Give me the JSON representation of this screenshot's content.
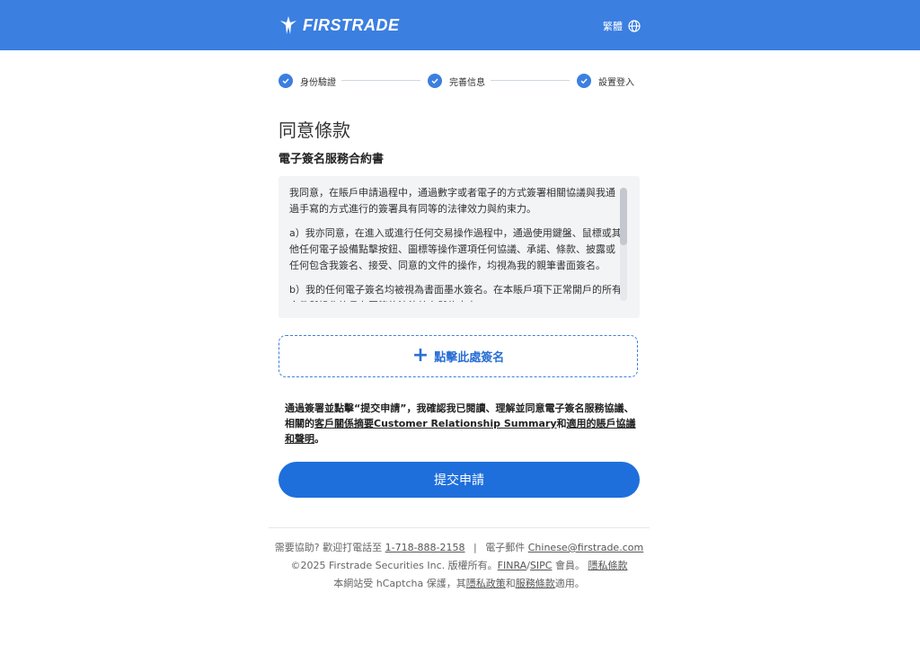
{
  "header": {
    "logo_text": "FIRSTRADE",
    "language_label": "繁體"
  },
  "stepper": {
    "steps": [
      {
        "label": "身份驗證",
        "completed": true
      },
      {
        "label": "完善信息",
        "completed": true
      },
      {
        "label": "設置登入",
        "completed": true
      }
    ]
  },
  "page": {
    "title": "同意條款",
    "section_title": "電子簽名服務合約書"
  },
  "agreement": {
    "paragraphs": [
      "我同意，在賬戶申請過程中，通過數字或者電子的方式簽署相關協議與我通過手寫的方式進行的簽署具有同等的法律效力與約束力。",
      "a）我亦同意，在進入或進行任何交易操作過程中，通過使用鍵盤、鼠標或其他任何電子設備點擊按鈕、圖標等操作選項任何協議、承諾、條款、披露或任何包含我簽名、接受、同意的文件的操作，均視為我的親筆書面簽名。",
      "b）我的任何電子簽名均被視為書面墨水簽名。在本賬戶項下正常開戶的所有文件與操作均具有同等的法律效力與約束力。"
    ]
  },
  "sign": {
    "label": "點擊此處簽名"
  },
  "consent": {
    "text_prefix": "通過簽署並點擊“提交申請”，我確認我已閱讀、理解並同意電子簽名服務協議、相關的",
    "link_crs": "客戶關係摘要Customer Relationship Summary",
    "text_mid": "和",
    "link_agreements": "適用的賬戶協議和聲明",
    "text_suffix": "。"
  },
  "submit": {
    "label": "提交申請"
  },
  "footer": {
    "help_prefix": "需要協助? 歡迎打電話至",
    "phone": "1-718-888-2158",
    "email_prefix": "電子郵件",
    "email": "Chinese@firstrade.com",
    "copyright": "©2025 Firstrade Securities Inc. 版權所有。",
    "finra": "FINRA",
    "slash": "/",
    "sipc": "SIPC",
    "member": "會員。",
    "privacy": "隱私條款",
    "hcaptcha_prefix": "本網站受 hCaptcha 保護，其",
    "privacy_policy": "隱私政策",
    "and": "和",
    "terms": "服務條款",
    "applies": "適用。"
  },
  "colors": {
    "brand": "#3b7fe0",
    "button": "#1e6fdc",
    "link": "#2a6fd6"
  }
}
